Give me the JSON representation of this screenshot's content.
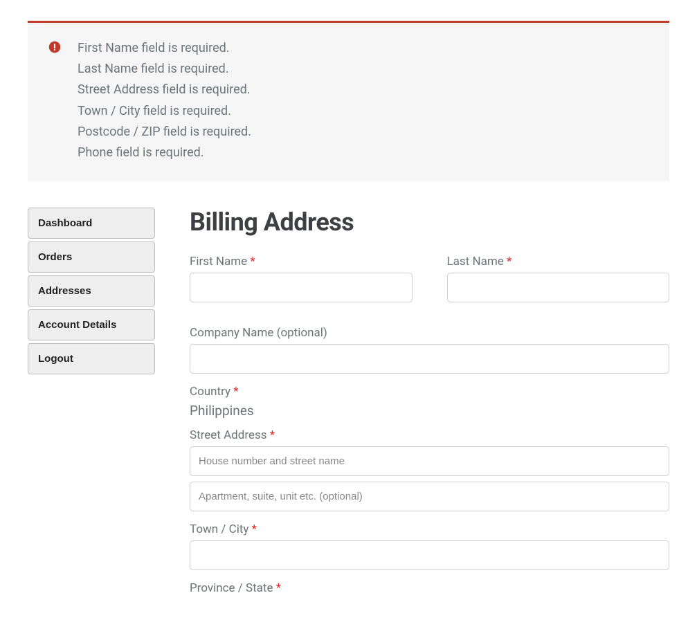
{
  "errors": {
    "messages": [
      "First Name field is required.",
      "Last Name field is required.",
      "Street Address field is required.",
      "Town / City field is required.",
      "Postcode / ZIP field is required.",
      "Phone field is required."
    ]
  },
  "sidebar": {
    "items": [
      {
        "label": "Dashboard"
      },
      {
        "label": "Orders"
      },
      {
        "label": "Addresses"
      },
      {
        "label": "Account Details"
      },
      {
        "label": "Logout"
      }
    ]
  },
  "form": {
    "title": "Billing Address",
    "first_name": {
      "label": "First Name ",
      "value": ""
    },
    "last_name": {
      "label": "Last Name ",
      "value": ""
    },
    "company": {
      "label": "Company Name (optional)",
      "value": ""
    },
    "country": {
      "label": "Country ",
      "value": "Philippines"
    },
    "street": {
      "label": "Street Address ",
      "line1_placeholder": "House number and street name",
      "line2_placeholder": "Apartment, suite, unit etc. (optional)"
    },
    "city": {
      "label": "Town / City ",
      "value": ""
    },
    "province": {
      "label": "Province / State "
    },
    "required_mark": "*"
  }
}
